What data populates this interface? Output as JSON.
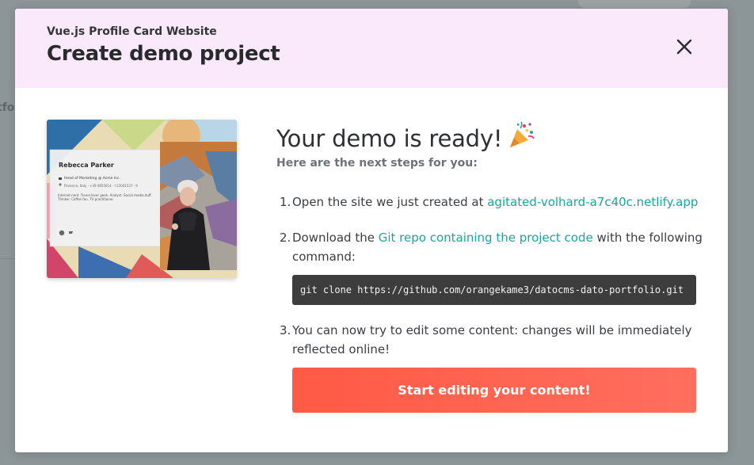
{
  "background": {
    "partial_text": "tfo"
  },
  "modal": {
    "subtitle": "Vue.js Profile Card Website",
    "title": "Create demo project",
    "close_icon": "close-icon",
    "header_color": "#fae8fb"
  },
  "preview": {
    "card_name": "Rebecca Parker",
    "card_role": "Head of Marketing @ Acme Inc.",
    "card_contact": "Florence, Italy · +39 0655614 · f 23041537 · 9",
    "card_bio": "Internet nerd. Travel lover geek. Analyst. Social media buff. Thinker. Coffee fan. TV practitioner.",
    "social_icons": [
      "facebook-icon",
      "twitter-icon"
    ]
  },
  "content": {
    "heading": "Your demo is ready!",
    "heading_icon": "party-popper-icon",
    "next_steps_label": "Here are the next steps for you:",
    "steps": [
      {
        "number": "1.",
        "text_before": "Open the site we just created at ",
        "link_text": "agitated-volhard-a7c40c.netlify.app"
      },
      {
        "number": "2.",
        "text_before": "Download the ",
        "link_text": "Git repo containing the project code",
        "text_after": " with the following command:"
      },
      {
        "number": "3.",
        "text": "You can now try to edit some content: changes will be immediately reflected online!"
      }
    ],
    "git_command": "git clone https://github.com/orangekame3/datocms-dato-portfolio.git",
    "cta_label": "Start editing your content!"
  },
  "colors": {
    "accent_link": "#1aa59c",
    "cta_start": "#ff5a45",
    "cta_end": "#ff6e5e",
    "code_bg": "#3d3d3d"
  }
}
